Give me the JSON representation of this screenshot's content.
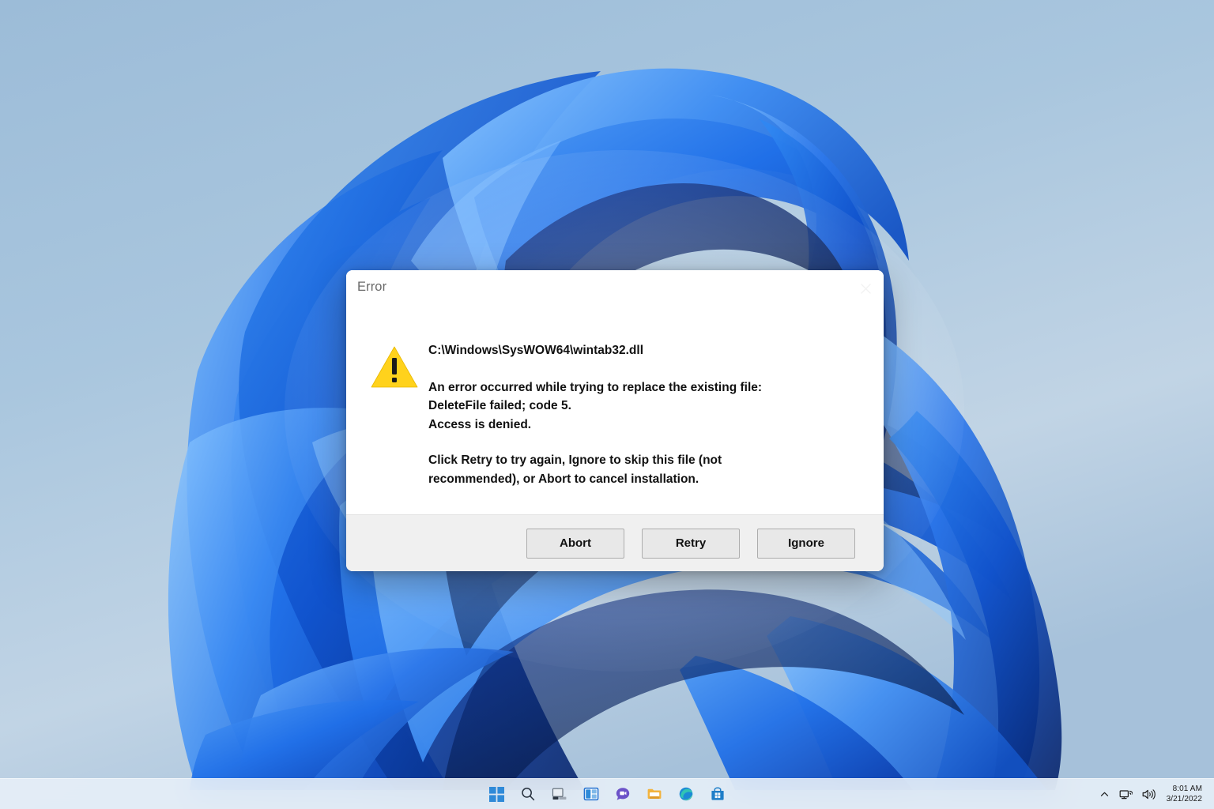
{
  "desktop": {
    "wallpaper_name": "windows-11-bloom-wallpaper",
    "background_top_color": "#9cbcd8",
    "background_bottom_color": "#9fbdd8",
    "ribbon_color_light": "#3e8ef0",
    "ribbon_color_mid": "#1560e0",
    "ribbon_color_dark": "#0a2f8f",
    "ribbon_color_deepest": "#051a52"
  },
  "dialog": {
    "title": "Error",
    "close_label": "✕",
    "icon": "warning-triangle-icon",
    "filepath": "C:\\Windows\\SysWOW64\\wintab32.dll",
    "paragraph1": {
      "line1": "An error occurred while trying to replace the existing file:",
      "line2": "DeleteFile failed; code 5.",
      "line3": "Access is denied."
    },
    "paragraph2": {
      "line1": "Click Retry to try again, Ignore to skip this file (not",
      "line2": "recommended), or Abort to cancel installation."
    },
    "buttons": {
      "abort": "Abort",
      "retry": "Retry",
      "ignore": "Ignore"
    },
    "colors": {
      "body_background": "#ffffff",
      "footer_background": "#f0f0f0",
      "title_text": "#6a6a6a",
      "body_text": "#111111",
      "button_face": "#e8e8e8",
      "button_border": "#adadad",
      "warning_yellow": "#ffd21c",
      "warning_mark": "#1a1a1a"
    }
  },
  "taskbar": {
    "items": [
      {
        "name": "start-button",
        "icon": "windows-logo-icon",
        "label": "Start"
      },
      {
        "name": "search-button",
        "icon": "search-icon",
        "label": "Search"
      },
      {
        "name": "task-view-button",
        "icon": "task-view-icon",
        "label": "Task View"
      },
      {
        "name": "widgets-button",
        "icon": "widgets-icon",
        "label": "Widgets"
      },
      {
        "name": "chat-button",
        "icon": "chat-icon",
        "label": "Chat"
      },
      {
        "name": "file-explorer-button",
        "icon": "file-explorer-icon",
        "label": "File Explorer"
      },
      {
        "name": "edge-button",
        "icon": "edge-icon",
        "label": "Microsoft Edge"
      },
      {
        "name": "store-button",
        "icon": "microsoft-store-icon",
        "label": "Microsoft Store"
      }
    ],
    "tray": {
      "chevron": "chevron-up-icon",
      "network": "network-icon",
      "volume": "volume-icon",
      "time": "8:01 AM",
      "date": "3/21/2022"
    },
    "background_color": "#e8f0f8"
  }
}
